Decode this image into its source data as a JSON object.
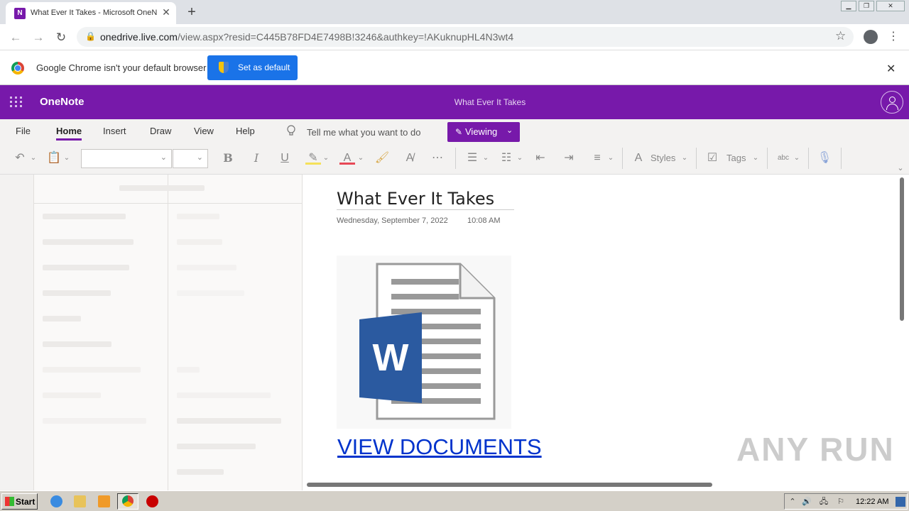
{
  "browser": {
    "tab": {
      "title": "What Ever It Takes - Microsoft OneN",
      "icon": "onenote-icon",
      "icon_letter": "N"
    },
    "new_tab": "+",
    "url_host": "onedrive.live.com",
    "url_path": "/view.aspx?resid=C445B78FD4E7498B!3246&authkey=!AKuknupHL4N3wt4"
  },
  "infobar": {
    "message": "Google Chrome isn't your default browser",
    "button": "Set as default",
    "close": "✕"
  },
  "app": {
    "name": "OneNote",
    "doc_title": "What Ever It Takes",
    "accent": "#7719aa"
  },
  "ribbon": {
    "tabs": [
      "File",
      "Home",
      "Insert",
      "Draw",
      "View",
      "Help"
    ],
    "tell_me": "Tell me what you want to do",
    "mode": "Viewing",
    "styles": "Styles",
    "tags": "Tags"
  },
  "page": {
    "title": "What Ever It Takes",
    "date": "Wednesday, September 7, 2022",
    "time": "10:08 AM",
    "link": "VIEW DOCUMENTS",
    "image_letter": "W"
  },
  "watermark": "ANY RUN",
  "taskbar": {
    "start": "Start",
    "clock": "12:22 AM"
  }
}
